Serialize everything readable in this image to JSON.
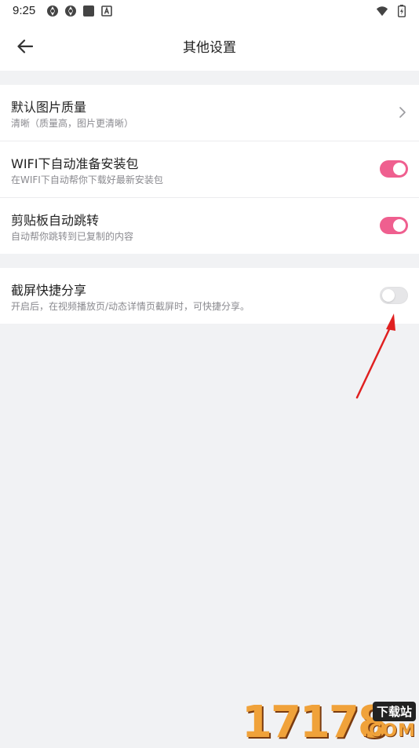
{
  "status_bar": {
    "time": "9:25",
    "left_icons": [
      "aperture-icon",
      "aperture-icon",
      "square-icon",
      "a-badge-icon"
    ],
    "right_icons": [
      "wifi-icon",
      "battery-charging-icon"
    ]
  },
  "header": {
    "title": "其他设置",
    "back_icon": "arrow-left-icon"
  },
  "settings": {
    "group1": [
      {
        "title": "默认图片质量",
        "subtitle": "清晰（质量高，图片更清晰）",
        "control": "chevron"
      },
      {
        "title": "WIFI下自动准备安装包",
        "subtitle": "在WIFI下自动帮你下载好最新安装包",
        "control": "toggle",
        "on": true
      },
      {
        "title": "剪贴板自动跳转",
        "subtitle": "自动帮你跳转到已复制的内容",
        "control": "toggle",
        "on": true
      }
    ],
    "group2": [
      {
        "title": "截屏快捷分享",
        "subtitle": "开启后，在视频播放页/动态详情页截屏时，可快捷分享。",
        "control": "toggle",
        "on": false
      }
    ]
  },
  "watermark": {
    "digits": "17178",
    "badge": "下载站",
    "suffix": ".COM"
  },
  "colors": {
    "accent": "#ef5f8f",
    "background": "#f1f2f4",
    "annotation_arrow": "#e02020"
  }
}
